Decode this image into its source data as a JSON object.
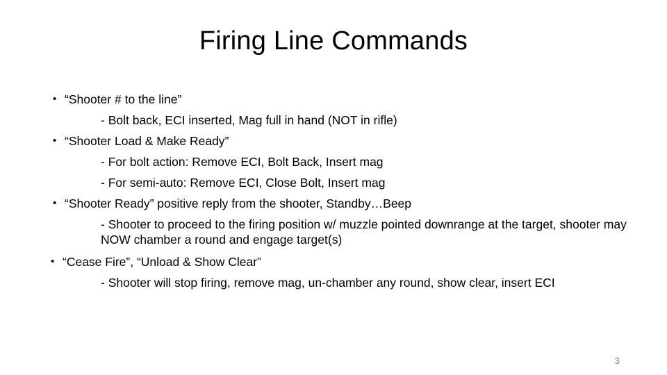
{
  "slide": {
    "title": "Firing Line Commands",
    "page_number": "3",
    "bullet_glyph": "•",
    "text_color": "#000000",
    "page_number_color": "#808080",
    "background_color": "#ffffff",
    "items": [
      {
        "bullet": "“Shooter # to the line”",
        "sub_lines": [
          "- Bolt back, ECI inserted, Mag full in hand (NOT in rifle)"
        ]
      },
      {
        "bullet": "“Shooter Load & Make Ready”",
        "sub_lines": [
          "- For bolt action: Remove ECI, Bolt Back, Insert mag",
          "- For semi-auto: Remove ECI, Close Bolt, Insert mag"
        ]
      },
      {
        "bullet": "“Shooter Ready” positive reply from the shooter, Standby…Beep",
        "sub_lines": [
          "- Shooter to proceed to the firing position w/ muzzle pointed downrange at the target, shooter may NOW chamber a round and engage target(s)"
        ]
      },
      {
        "bullet": "“Cease Fire”, “Unload & Show Clear”",
        "sub_lines": [
          "- Shooter will stop firing, remove mag, un-chamber any round, show clear, insert ECI"
        ]
      }
    ]
  }
}
